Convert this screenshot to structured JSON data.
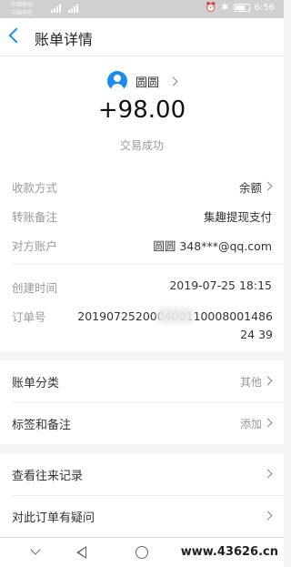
{
  "status_bar": {
    "carrier_1": "中国移动",
    "carrier_2": "中国电信",
    "battery": "",
    "time": "6:56"
  },
  "navbar": {
    "title": "账单详情"
  },
  "payee": {
    "name": "圆圆",
    "amount": "+98.00",
    "status": "交易成功"
  },
  "details": [
    {
      "label": "收款方式",
      "value": "余额"
    },
    {
      "label": "转账备注",
      "value": "集趣提现支付"
    },
    {
      "label": "对方账户",
      "value": "圆圆 348***@qq.com"
    },
    {
      "label": "创建时间",
      "value": "2019-07-25 18:15"
    },
    {
      "label": "订单号",
      "value": "20190725200040011000800148624 39"
    }
  ],
  "group1": [
    {
      "label": "账单分类",
      "value": "其他"
    },
    {
      "label": "标签和备注",
      "value": "添加"
    }
  ],
  "group2": [
    {
      "label": "查看往来记录"
    },
    {
      "label": "对此订单有疑问"
    }
  ],
  "watermark": "www.43626.cn",
  "colors": {
    "accent": "#1a8cf0",
    "background": "#f5f5f5"
  }
}
